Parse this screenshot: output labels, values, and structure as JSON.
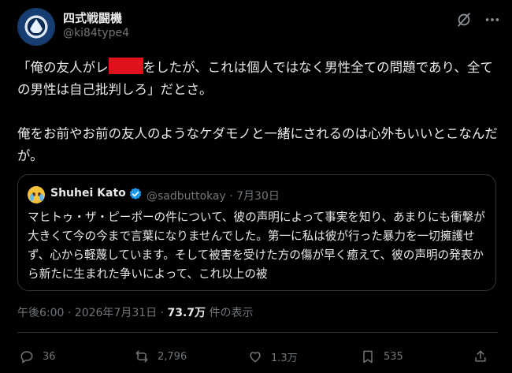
{
  "author": {
    "display_name": "四式戦闘機",
    "handle": "@ki84type4"
  },
  "tweet": {
    "text_part1": "「俺の友人がレ",
    "text_part2": "をしたが、これは個人ではなく男性全ての問題であり、全ての男性は自己批判しろ」だとさ。\n\n俺をお前やお前の友人のようなケダモノと一緒にされるのは心外もいいとこなんだが。"
  },
  "quote": {
    "display_name": "Shuhei Kato",
    "handle_date": "@sadbuttokay · 7月30日",
    "text": "マヒトゥ・ザ・ピーポーの件について、彼の声明によって事実を知り、あまりにも衝撃が大きくて今の今まで言葉になりませんでした。第一に私は彼が行った暴力を一切擁護せず、心から軽蔑しています。そして被害を受けた方の傷が早く癒えて、彼の声明の発表から新たに生まれた争いによって、これ以上の被"
  },
  "meta": {
    "timestamp": "午後6:00 · 2026年7月31日 · ",
    "views": "73.7万",
    "views_suffix": " 件の表示"
  },
  "actions": {
    "replies": "36",
    "reposts": "2,796",
    "likes": "1.3万",
    "bookmarks": "535"
  },
  "icons": [
    "grok-icon",
    "more-icon",
    "verified-icon",
    "reply-icon",
    "repost-icon",
    "like-icon",
    "bookmark-icon",
    "share-icon"
  ],
  "colors": {
    "accent": "#1d9bf0",
    "redaction": "#e0101c",
    "muted": "#71767b"
  }
}
